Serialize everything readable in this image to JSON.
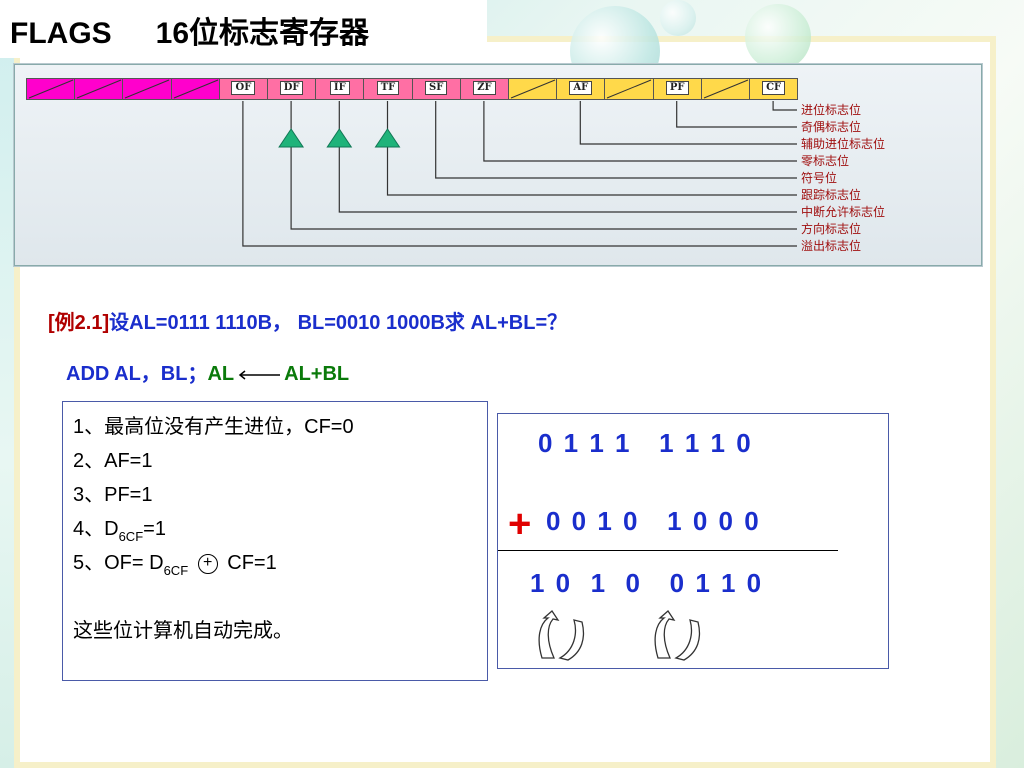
{
  "title": {
    "main": "FLAGS",
    "sub": "16位标志寄存器"
  },
  "flags": {
    "bits": [
      "",
      "",
      "",
      "",
      "OF",
      "DF",
      "IF",
      "TF",
      "SF",
      "ZF",
      "",
      "AF",
      "",
      "PF",
      "",
      "CF"
    ],
    "descriptions": [
      "进位标志位",
      "奇偶标志位",
      "辅助进位标志位",
      "零标志位",
      "符号位",
      "跟踪标志位",
      "中断允许标志位",
      "方向标志位",
      "溢出标志位"
    ],
    "colors": {
      "high": "#ff00cc",
      "mid": "#ff6fa4",
      "low": "#ffd94a",
      "arrow": "#1fb37a"
    }
  },
  "example": {
    "prefix": "[例2.1]",
    "text": "设AL=0111 1110B，  BL=0010 1000B求 AL+BL=？",
    "instruction": "ADD AL，BL；",
    "comment_left": "AL",
    "comment_right": "AL+BL"
  },
  "results": {
    "line1": "1、最高位没有产生进位，CF=0",
    "line2": "2、AF=1",
    "line3": "3、PF=1",
    "line4_a": "4、D",
    "line4_sub": "6CF",
    "line4_b": "=1",
    "line5_a": "5、OF= D",
    "line5_sub": "6CF",
    "line5_xor": "+",
    "line5_b": "CF=1",
    "note": "这些位计算机自动完成。"
  },
  "calc": {
    "a": "0 1 1 1   1 1 1 0",
    "b": "0 0 1 0   1 0 0 0",
    "sum": "1 0  1  0   0 1 1 0",
    "plus": "+"
  }
}
